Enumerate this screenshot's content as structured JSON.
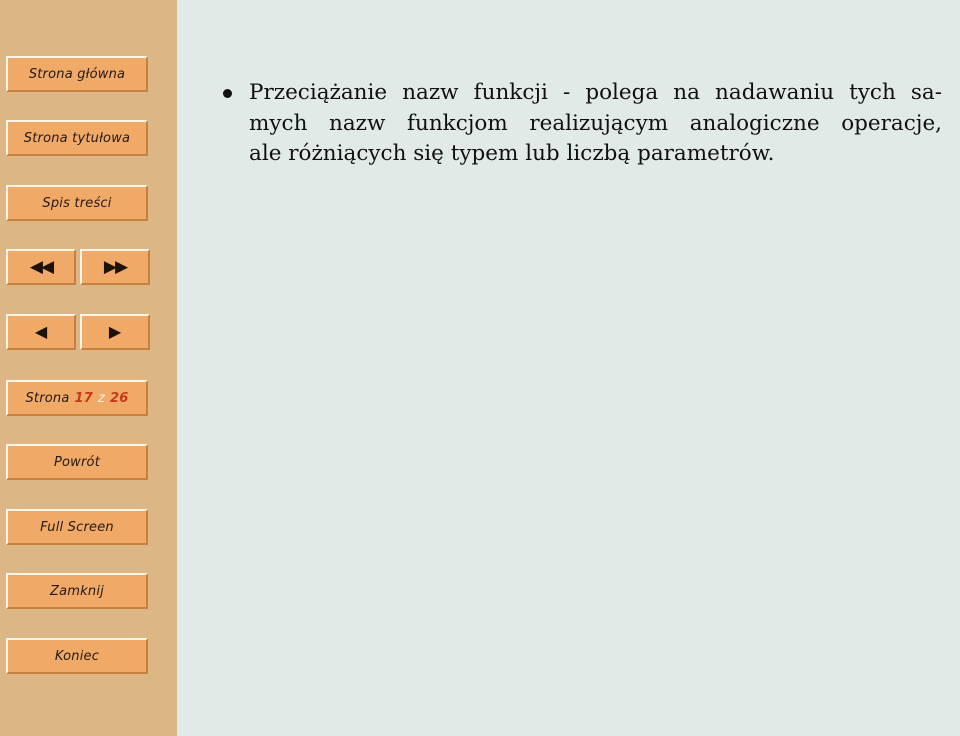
{
  "theme": {
    "sidebar_bg": "#ddb685",
    "content_bg": "#e2eae7",
    "button_fill": "#f1a967",
    "button_highlight": "#fdf6e6",
    "button_shadow": "#c8803e",
    "text_dark": "#241a12",
    "accent_red": "#c43a1a",
    "counter_sep": "#fbf3e2"
  },
  "sidebar": {
    "nav_buttons": [
      {
        "name": "home",
        "label": "Strona główna"
      },
      {
        "name": "title-page",
        "label": "Strona tytułowa"
      },
      {
        "name": "contents",
        "label": "Spis treści"
      }
    ],
    "arrow_buttons": [
      {
        "name": "first-page",
        "icon": "double-left-arrow-icon",
        "glyph": "◀◀"
      },
      {
        "name": "last-page",
        "icon": "double-right-arrow-icon",
        "glyph": "▶▶"
      },
      {
        "name": "previous-page",
        "icon": "left-arrow-icon",
        "glyph": "◀"
      },
      {
        "name": "next-page",
        "icon": "right-arrow-icon",
        "glyph": "▶"
      }
    ],
    "page_counter": {
      "word": "Strona",
      "current": "17",
      "separator": "z",
      "total": "26"
    },
    "action_buttons": [
      {
        "name": "back",
        "label": "Powrót"
      },
      {
        "name": "full-screen",
        "label": "Full Screen"
      },
      {
        "name": "close",
        "label": "Zamknij"
      },
      {
        "name": "end",
        "label": "Koniec"
      }
    ]
  },
  "content": {
    "bullets": [
      {
        "lines": [
          "Przeciążanie nazw funkcji - polega na nadawaniu tych sa-",
          "mych nazw funkcjom realizującym analogiczne operacje,",
          "ale różniących się typem lub liczbą parametrów."
        ]
      }
    ]
  }
}
